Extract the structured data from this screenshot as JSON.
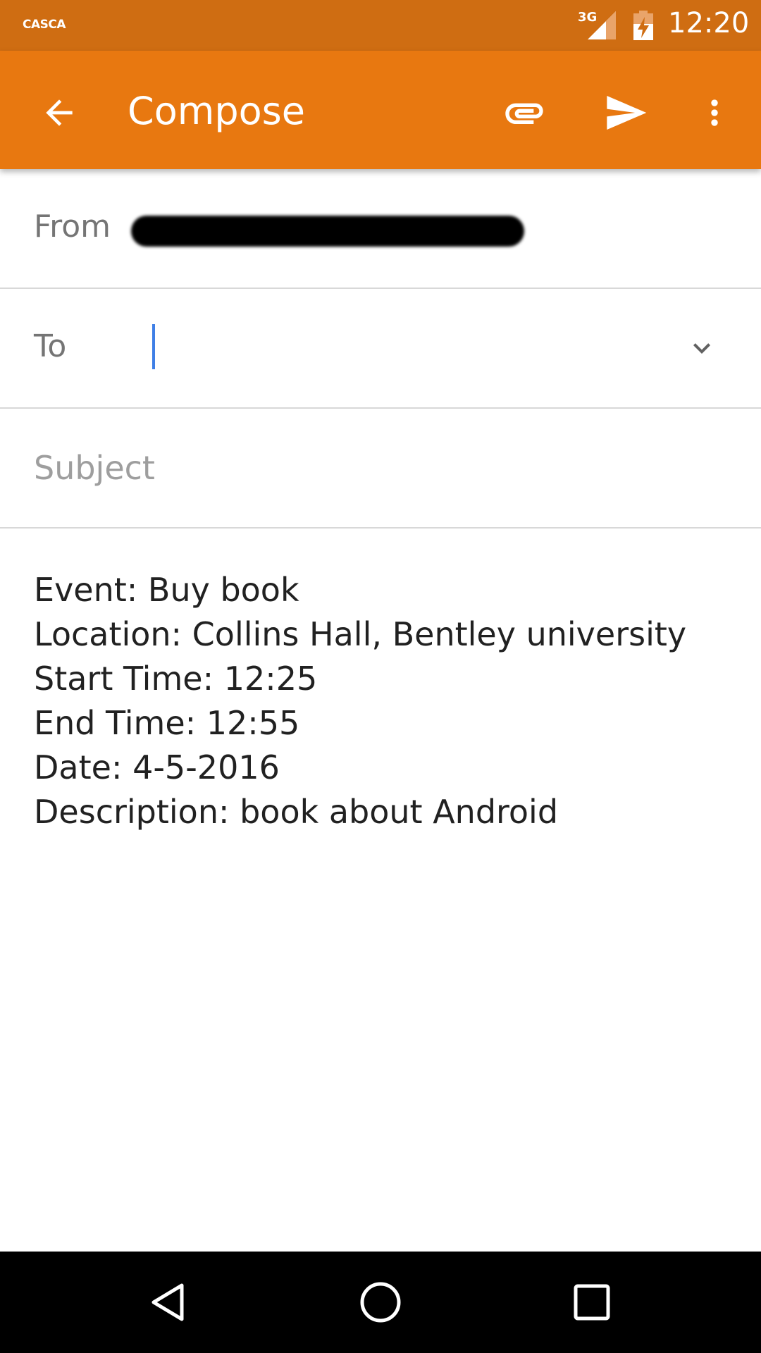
{
  "status_bar": {
    "carrier": "CASCA",
    "network_type": "3G",
    "time": "12:20",
    "icons": [
      "signal-icon",
      "battery-charging-icon"
    ]
  },
  "app_bar": {
    "title": "Compose",
    "icons": [
      "back-arrow-icon",
      "paperclip-icon",
      "send-icon",
      "more-vert-icon"
    ],
    "color": "#e87810",
    "status_color": "#cf6d12"
  },
  "form": {
    "from_label": "From",
    "to_label": "To",
    "to_value": "",
    "subject_placeholder": "Subject",
    "subject_value": ""
  },
  "body": {
    "lines": [
      "Event: Buy book",
      "Location: Collins Hall, Bentley university",
      "Start Time: 12:25",
      "End Time: 12:55",
      "Date: 4-5-2016",
      "Description: book about Android"
    ]
  },
  "nav_bar": {
    "icons": [
      "nav-back-icon",
      "nav-home-icon",
      "nav-recents-icon"
    ]
  },
  "colors": {
    "accent": "#e87810",
    "cursor": "#3f7fe6",
    "divider": "#d8d8d8",
    "label": "#757575",
    "text": "#212121"
  }
}
